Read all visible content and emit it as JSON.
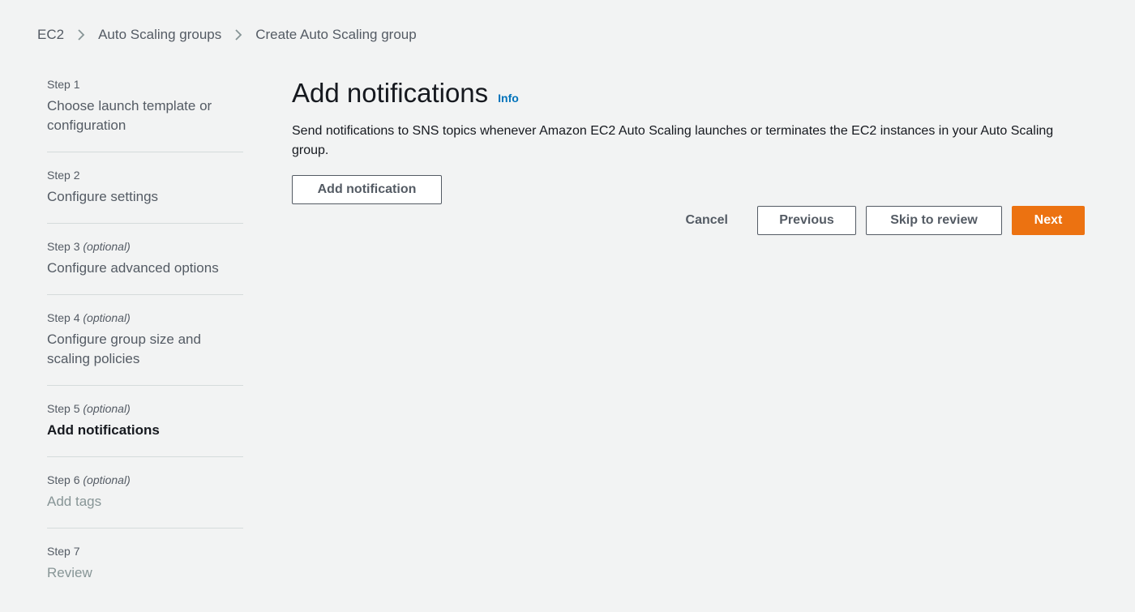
{
  "breadcrumb": {
    "items": [
      "EC2",
      "Auto Scaling groups",
      "Create Auto Scaling group"
    ]
  },
  "steps": [
    {
      "number": "Step 1",
      "optional": "",
      "title": "Choose launch template or configuration",
      "state": "link"
    },
    {
      "number": "Step 2",
      "optional": "",
      "title": "Configure settings",
      "state": "link"
    },
    {
      "number": "Step 3",
      "optional": "(optional)",
      "title": "Configure advanced options",
      "state": "link"
    },
    {
      "number": "Step 4",
      "optional": "(optional)",
      "title": "Configure group size and scaling policies",
      "state": "link"
    },
    {
      "number": "Step 5",
      "optional": "(optional)",
      "title": "Add notifications",
      "state": "active"
    },
    {
      "number": "Step 6",
      "optional": "(optional)",
      "title": "Add tags",
      "state": "disabled"
    },
    {
      "number": "Step 7",
      "optional": "",
      "title": "Review",
      "state": "disabled"
    }
  ],
  "main": {
    "title": "Add notifications",
    "info_label": "Info",
    "description": "Send notifications to SNS topics whenever Amazon EC2 Auto Scaling launches or terminates the EC2 instances in your Auto Scaling group.",
    "add_button_label": "Add notification"
  },
  "actions": {
    "cancel_label": "Cancel",
    "previous_label": "Previous",
    "skip_label": "Skip to review",
    "next_label": "Next"
  },
  "colors": {
    "primary": "#ec7211",
    "link": "#0073bb",
    "background": "#f2f3f3"
  }
}
